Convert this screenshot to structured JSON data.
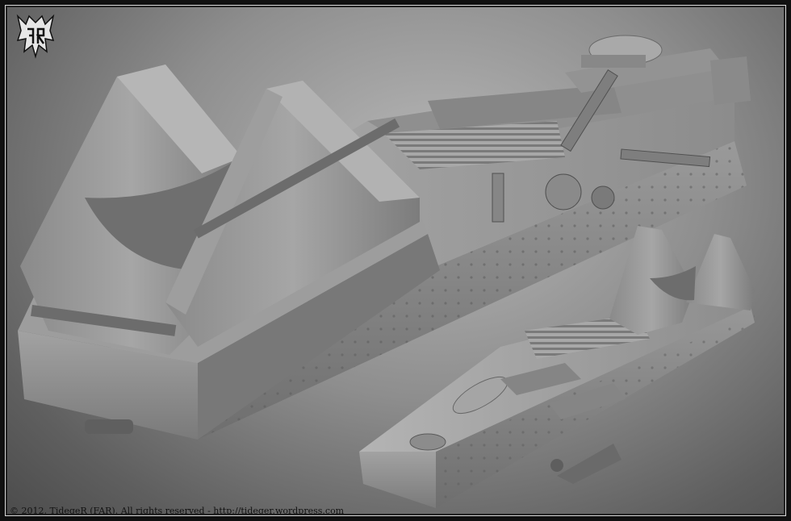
{
  "footer": {
    "copyright": "© 2012, TidegeR (FAR). All rights reserved - http://tideger.wordpress.com"
  },
  "logo": {
    "icon": "far-monogram-logo",
    "text": "FAR"
  },
  "scene": {
    "subject": "3d-railway-gun-carriage-render",
    "colors": {
      "background": "#8e8e8e",
      "model": "#9a9a9a",
      "shadow": "#5e5e5e",
      "frame": "#111111"
    }
  }
}
